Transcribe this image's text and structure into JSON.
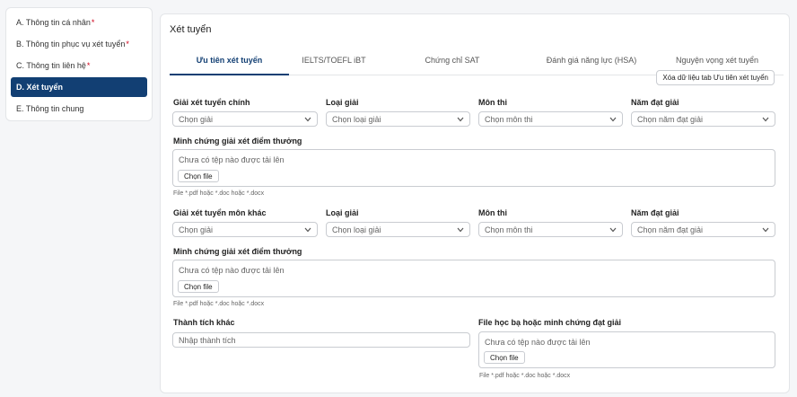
{
  "sidebar": {
    "items": [
      {
        "label": "A. Thông tin cá nhân",
        "required": true
      },
      {
        "label": "B. Thông tin phục vụ xét tuyển",
        "required": true
      },
      {
        "label": "C. Thông tin liên hệ",
        "required": true
      },
      {
        "label": "D. Xét tuyển",
        "required": false,
        "active": true
      },
      {
        "label": "E. Thông tin chung",
        "required": false
      }
    ],
    "required_mark": "*"
  },
  "panel": {
    "title": "Xét tuyển",
    "tabs": [
      {
        "label": "Ưu tiên xét tuyển",
        "active": true
      },
      {
        "label": "IELTS/TOEFL iBT"
      },
      {
        "label": "Chứng chỉ SAT"
      },
      {
        "label": "Đánh giá năng lực (HSA)"
      },
      {
        "label": "Nguyện vọng xét tuyển"
      }
    ],
    "clear_button": "Xóa dữ liệu tab Ưu tiên xét tuyển"
  },
  "section1": {
    "award_label": "Giải xét tuyển chính",
    "award_placeholder": "Chọn giải",
    "type_label": "Loại giải",
    "type_placeholder": "Chọn loại giải",
    "subject_label": "Môn thi",
    "subject_placeholder": "Chọn môn thi",
    "year_label": "Năm đạt giải",
    "year_placeholder": "Chọn năm đạt giải",
    "proof_label": "Minh chứng giải xét điểm thưởng",
    "no_file": "Chưa có tệp nào được tải lên",
    "choose_file": "Chọn file",
    "hint": "File *.pdf hoặc *.doc hoặc *.docx"
  },
  "section2": {
    "award_label": "Giải xét tuyển môn khác",
    "award_placeholder": "Chọn giải",
    "type_label": "Loại giải",
    "type_placeholder": "Chọn loại giải",
    "subject_label": "Môn thi",
    "subject_placeholder": "Chọn môn thi",
    "year_label": "Năm đạt giải",
    "year_placeholder": "Chọn năm đạt giải",
    "proof_label": "Minh chứng giải xét điểm thưởng",
    "no_file": "Chưa có tệp nào được tải lên",
    "choose_file": "Chọn file",
    "hint": "File *.pdf hoặc *.doc hoặc *.docx"
  },
  "section3": {
    "achievement_label": "Thành tích khác",
    "achievement_placeholder": "Nhập thành tích",
    "transcript_label": "File học bạ hoặc minh chứng đạt giải",
    "no_file": "Chưa có tệp nào được tải lên",
    "choose_file": "Chọn file",
    "hint": "File *.pdf hoặc *.doc hoặc *.docx"
  },
  "colors": {
    "accent": "#123f73",
    "required": "#d0021b"
  }
}
